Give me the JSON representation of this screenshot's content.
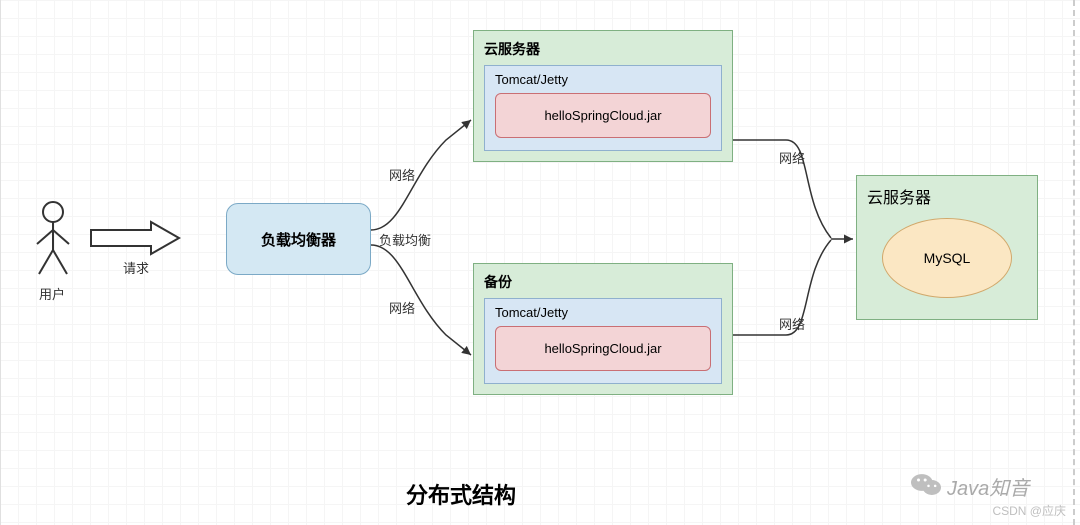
{
  "actors": {
    "user_label": "用户"
  },
  "arrows": {
    "request_label": "请求",
    "network_label_top": "网络",
    "load_balance_label": "负载均衡",
    "network_label_bottom": "网络",
    "network_label_right_top": "网络",
    "network_label_right_bottom": "网络"
  },
  "load_balancer": {
    "label": "负载均衡器"
  },
  "cloud_server_1": {
    "header": "云服务器",
    "tomcat_label": "Tomcat/Jetty",
    "jar_label": "helloSpringCloud.jar"
  },
  "cloud_server_2": {
    "header": "备份",
    "tomcat_label": "Tomcat/Jetty",
    "jar_label": "helloSpringCloud.jar"
  },
  "db_server": {
    "header": "云服务器",
    "db_label": "MySQL"
  },
  "diagram_title": "分布式结构",
  "watermark_small": "CSDN @应庆",
  "watermark_java": "Java知音"
}
